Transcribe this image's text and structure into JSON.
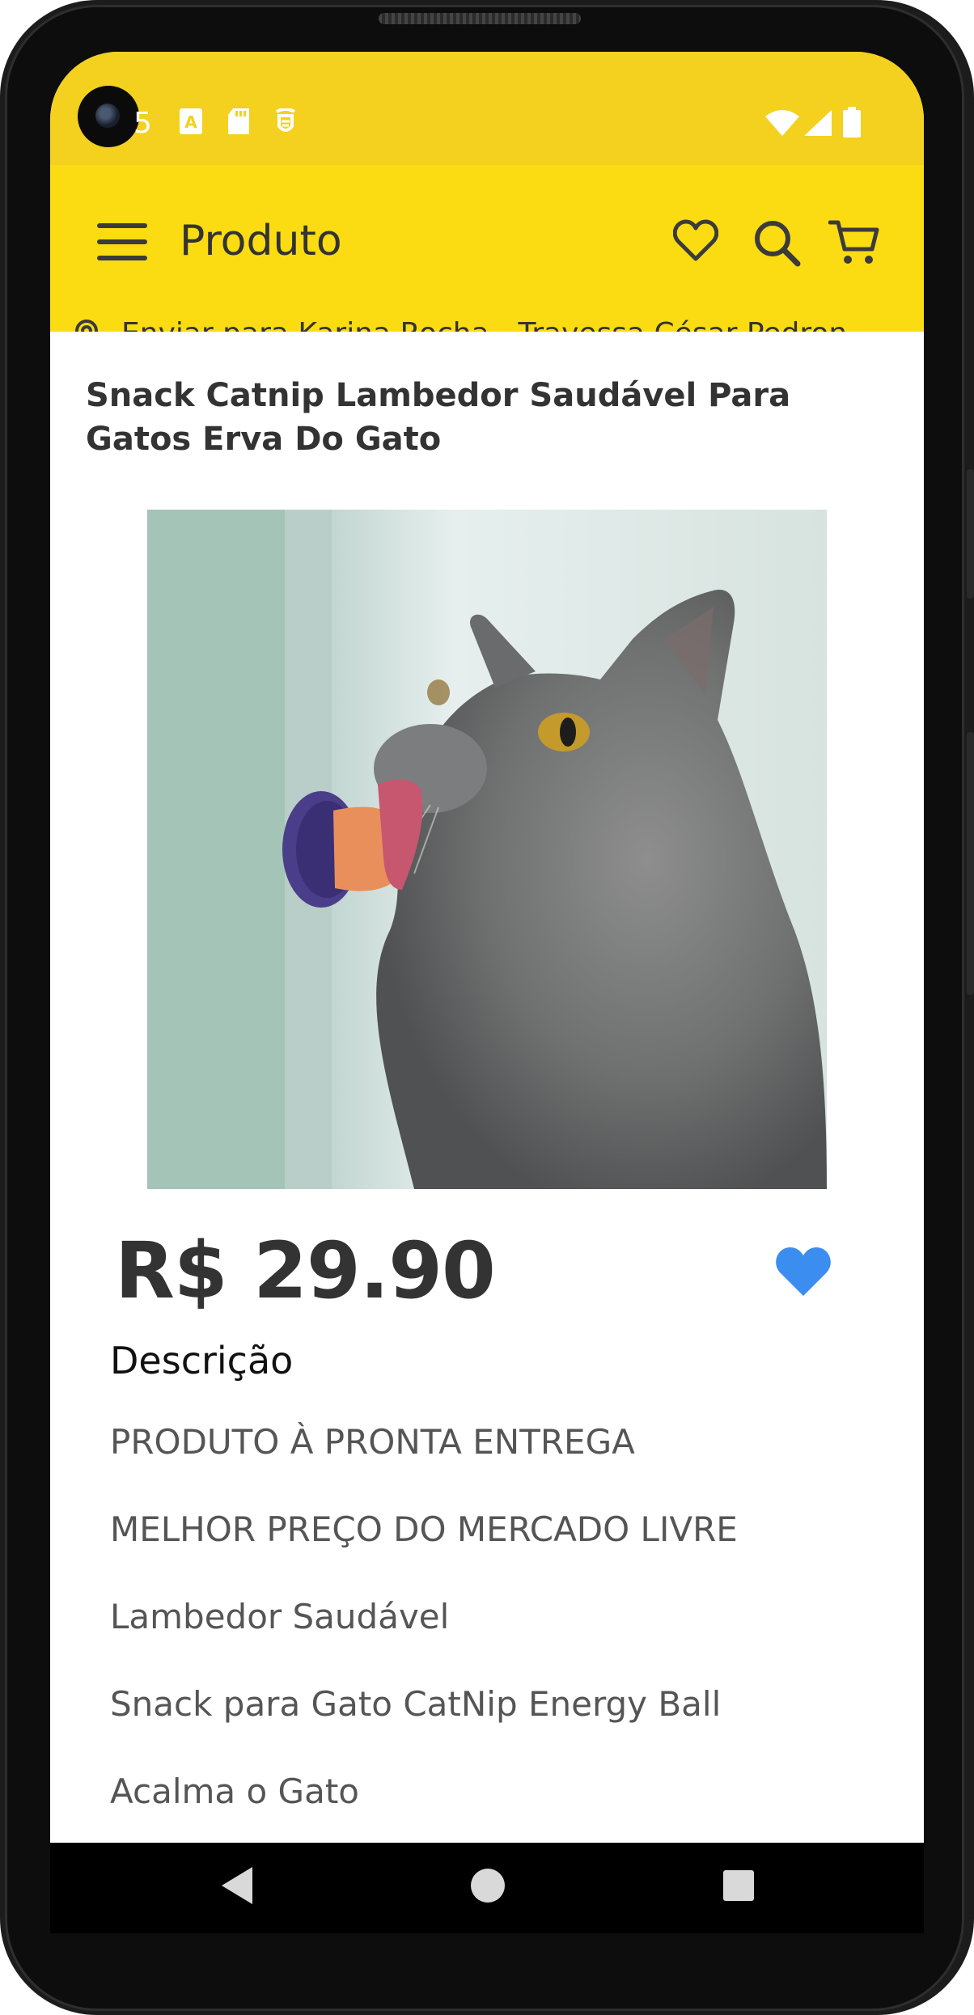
{
  "status_bar": {
    "time_fragment": "5",
    "icons": [
      "android-a-icon",
      "sd-card-icon",
      "notification-icon",
      "wifi-icon",
      "signal-icon",
      "battery-icon"
    ]
  },
  "app_bar": {
    "title": "Produto",
    "icons": [
      "menu-icon",
      "heart-outline-icon",
      "search-icon",
      "cart-icon"
    ],
    "ship_to": "Enviar para Karina Rocha - Travessa César Pedron"
  },
  "product": {
    "title": "Snack Catnip Lambedor Saudável Para Gatos Erva Do Gato",
    "price": "R$ 29.90",
    "favorite": true
  },
  "description": {
    "title": "Descrição",
    "lines": [
      "PRODUTO À PRONTA ENTREGA",
      "MELHOR PREÇO DO MERCADO LIVRE",
      "Lambedor Saudável",
      "Snack para Gato CatNip Energy Ball",
      "Acalma o Gato"
    ]
  },
  "nav_bar": {
    "icons": [
      "back-icon",
      "home-icon",
      "recents-icon"
    ]
  },
  "colors": {
    "status_bar": "#f3d11e",
    "app_bar": "#fbdc13",
    "heart_accent": "#3b8df0",
    "text_dark": "#333333",
    "text_muted": "#555555"
  }
}
